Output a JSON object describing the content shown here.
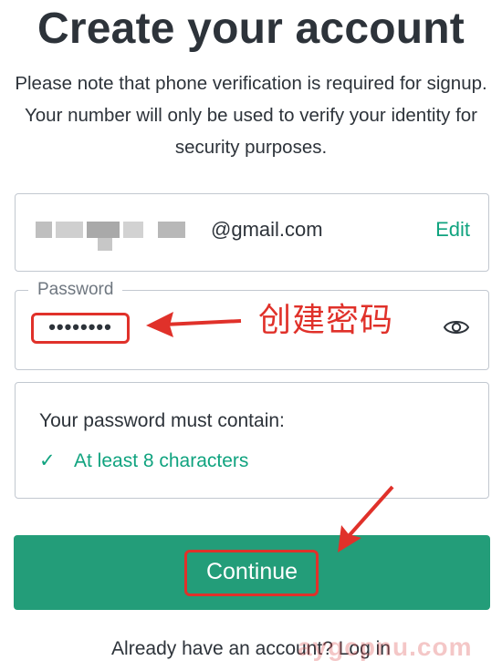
{
  "header": {
    "title": "Create your account",
    "subtitle": "Please note that phone verification is required for signup. Your number will only be used to verify your identity for security purposes."
  },
  "email": {
    "domain": "@gmail.com",
    "edit_label": "Edit"
  },
  "password": {
    "label": "Password",
    "masked_value": "••••••••",
    "toggle_icon": "eye-icon"
  },
  "annotations": {
    "password_note": "创建密码",
    "watermark": "aygcpnu.com"
  },
  "requirements": {
    "title": "Your password must contain:",
    "items": [
      {
        "check": "✓",
        "label": "At least 8 characters"
      }
    ]
  },
  "actions": {
    "continue_label": "Continue"
  },
  "footer": {
    "prompt": "Already have an account? ",
    "login_label": "Log in"
  },
  "colors": {
    "accent": "#10a37f",
    "button": "#239d79",
    "annotation": "#e0312a",
    "text": "#2d333a",
    "border": "#c2c8d0"
  }
}
